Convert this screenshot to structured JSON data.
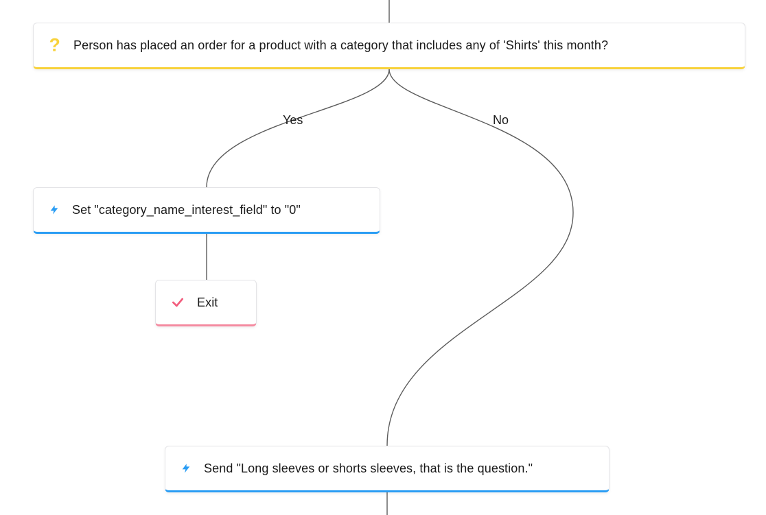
{
  "branches": {
    "yes": "Yes",
    "no": "No"
  },
  "nodes": {
    "condition": {
      "icon": "question-icon",
      "text": "Person has placed an order for a product with a category that includes any of 'Shirts' this month?"
    },
    "set_field": {
      "icon": "bolt-icon",
      "text": "Set \"category_name_interest_field\" to \"0\""
    },
    "exit": {
      "icon": "check-icon",
      "text": "Exit"
    },
    "send": {
      "icon": "bolt-icon",
      "text": "Send \"Long sleeves or shorts sleeves, that is the question.\""
    }
  },
  "colors": {
    "condition": "#f8d23b",
    "action": "#2a9df4",
    "exit": "#f48aa0",
    "connector": "#5b5b5b"
  }
}
